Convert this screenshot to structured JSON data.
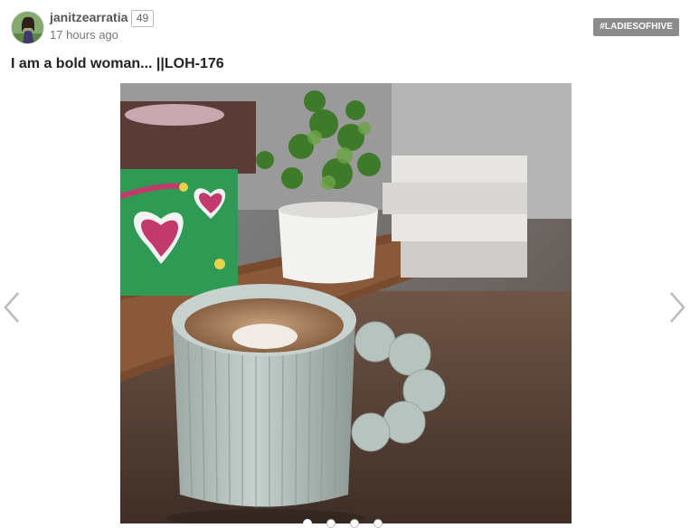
{
  "post": {
    "author": "janitzearratia",
    "reputation": "49",
    "timestamp": "17 hours ago",
    "tag": "#LADIESOFHIVE",
    "title": "I am a bold woman... ||LOH-176"
  },
  "carousel": {
    "slide_count": 4,
    "active_slide": 1,
    "prev_icon": "chevron-left-icon",
    "next_icon": "chevron-right-icon"
  },
  "colors": {
    "tag_background": "#8c8c8c",
    "mug": "#b6c2be"
  }
}
